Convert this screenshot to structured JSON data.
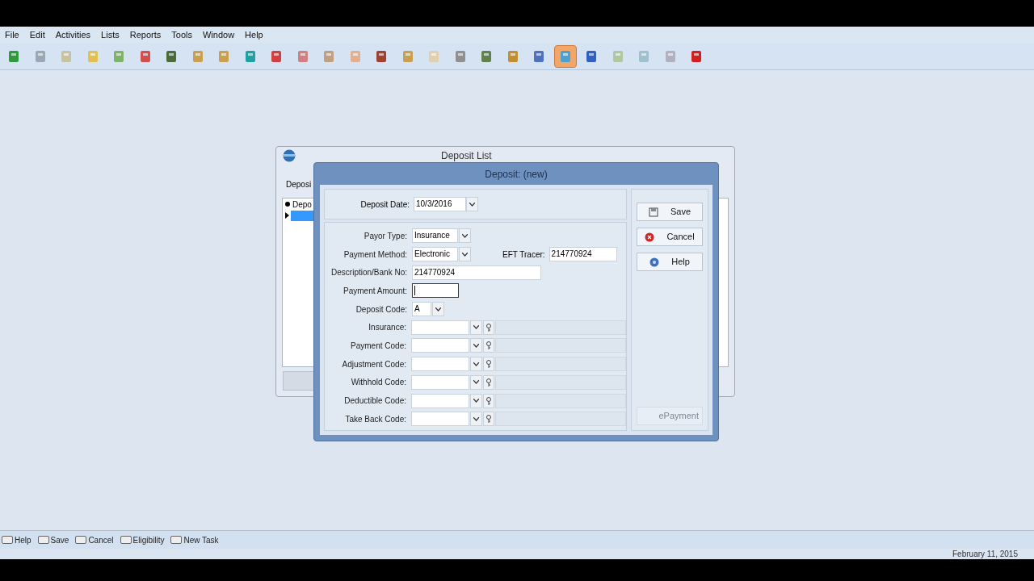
{
  "menu": [
    "File",
    "Edit",
    "Activities",
    "Lists",
    "Reports",
    "Tools",
    "Window",
    "Help"
  ],
  "toolbar": [
    {
      "selected": false
    },
    {
      "selected": false
    },
    {
      "selected": false
    },
    {
      "selected": false
    },
    {
      "selected": false
    },
    {
      "selected": false
    },
    {
      "selected": false
    },
    {
      "selected": false
    },
    {
      "selected": false
    },
    {
      "selected": false
    },
    {
      "selected": false
    },
    {
      "selected": false
    },
    {
      "selected": false
    },
    {
      "selected": false
    },
    {
      "selected": false
    },
    {
      "selected": false
    },
    {
      "selected": false
    },
    {
      "selected": false
    },
    {
      "selected": false
    },
    {
      "selected": false
    },
    {
      "selected": false
    },
    {
      "selected": true
    },
    {
      "selected": false
    },
    {
      "selected": false
    },
    {
      "selected": false
    },
    {
      "selected": false
    },
    {
      "selected": false
    }
  ],
  "back_window": {
    "title": "Deposit List",
    "tab": "Deposi",
    "list_header": "Depo"
  },
  "dialog": {
    "title": "Deposit: (new)",
    "header_field": {
      "label": "Deposit Date:",
      "value": "10/3/2016"
    },
    "fields": [
      {
        "kind": "combo",
        "label": "Payor Type:",
        "value": "Insurance",
        "focused": false
      },
      {
        "kind": "combo",
        "label": "Payment Method:",
        "value": "Electronic",
        "focused": false,
        "extra": {
          "label": "EFT Tracer:",
          "value": "214770924"
        }
      },
      {
        "kind": "text",
        "label": "Description/Bank No:",
        "value": "214770924",
        "focused": false
      },
      {
        "kind": "amount",
        "label": "Payment Amount:",
        "focused": true
      },
      {
        "kind": "short",
        "label": "Deposit Code:",
        "value": "A",
        "focused": false
      },
      {
        "kind": "lookup",
        "label": "Insurance:",
        "focused": false
      },
      {
        "kind": "lookup",
        "label": "Payment Code:",
        "focused": false
      },
      {
        "kind": "lookup",
        "label": "Adjustment Code:",
        "focused": false
      },
      {
        "kind": "lookup",
        "label": "Withhold Code:",
        "focused": false
      },
      {
        "kind": "lookup",
        "label": "Deductible Code:",
        "focused": false
      },
      {
        "kind": "lookup",
        "label": "Take Back Code:",
        "focused": false
      }
    ],
    "buttons": [
      {
        "kind": "save",
        "label": "Save",
        "disabled": false
      },
      {
        "kind": "cancel",
        "label": "Cancel",
        "disabled": false
      },
      {
        "kind": "help",
        "label": "Help",
        "disabled": false
      },
      {
        "kind": "epayment",
        "label": "ePayment",
        "disabled": true
      }
    ]
  },
  "status_bar": [
    "Help",
    "Save",
    "Cancel",
    "Eligibility",
    "New Task"
  ],
  "date": "February 11, 2015"
}
